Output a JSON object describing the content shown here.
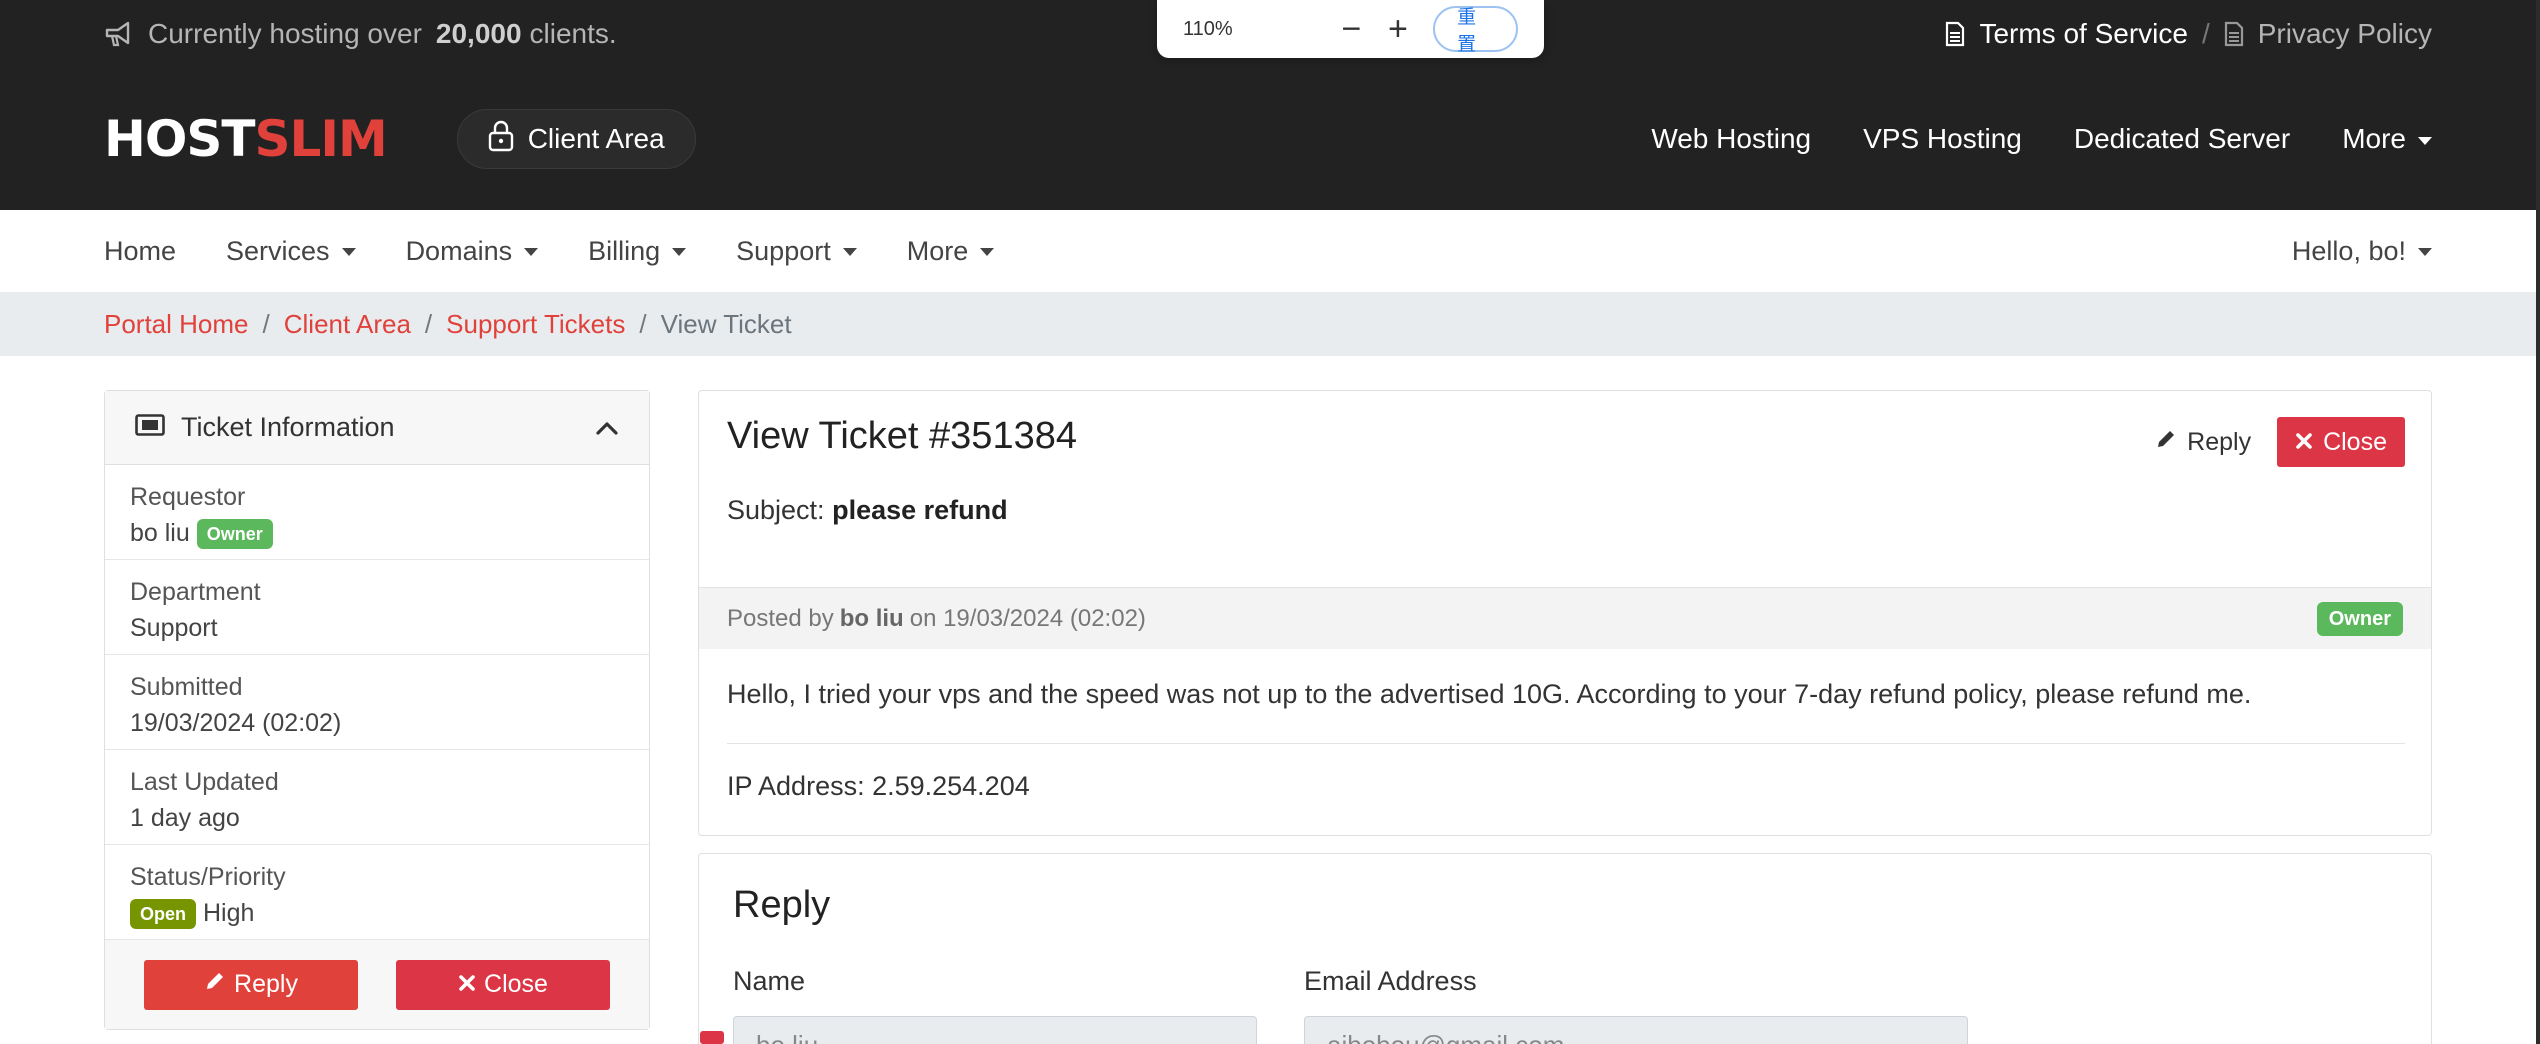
{
  "topbar": {
    "announcement_prefix": "Currently hosting over",
    "announcement_count": "20,000",
    "announcement_suffix": "clients.",
    "terms": "Terms of Service",
    "separator": "/",
    "privacy": "Privacy Policy"
  },
  "zoom": {
    "level": "110%",
    "minus": "−",
    "plus": "+",
    "reset": "重置"
  },
  "header": {
    "logo_host": "HOST",
    "logo_slim": "SLIM",
    "client_area": "Client Area",
    "nav": [
      "Web Hosting",
      "VPS Hosting",
      "Dedicated Server",
      "More"
    ]
  },
  "subnav": {
    "home": "Home",
    "services": "Services",
    "domains": "Domains",
    "billing": "Billing",
    "support": "Support",
    "more": "More",
    "user": "Hello, bo!"
  },
  "breadcrumb": {
    "portal_home": "Portal Home",
    "client_area": "Client Area",
    "support_tickets": "Support Tickets",
    "current": "View Ticket",
    "sep": "/"
  },
  "sidebar": {
    "title": "Ticket Information",
    "requestor_label": "Requestor",
    "requestor_value": "bo liu",
    "owner_badge": "Owner",
    "department_label": "Department",
    "department_value": "Support",
    "submitted_label": "Submitted",
    "submitted_value": "19/03/2024 (02:02)",
    "updated_label": "Last Updated",
    "updated_value": "1 day ago",
    "status_label": "Status/Priority",
    "status_badge": "Open",
    "priority_value": "High",
    "reply_button": "Reply",
    "close_button": "Close"
  },
  "ticket": {
    "title": "View Ticket #351384",
    "reply_link": "Reply",
    "close_button": "Close",
    "subject_label": "Subject:",
    "subject_value": "please refund",
    "posted_by": "Posted by",
    "author": "bo liu",
    "posted_on": "on 19/03/2024 (02:02)",
    "author_badge": "Owner",
    "message": "Hello, I tried your vps and the speed was not up to the advertised 10G. According to your 7-day refund policy, please refund me.",
    "ip": "IP Address: 2.59.254.204"
  },
  "reply": {
    "title": "Reply",
    "name_label": "Name",
    "email_label": "Email Address",
    "name_value": "bo liu",
    "email_value": "aibobou@gmail.com"
  },
  "colors": {
    "brand_red": "#e0423b",
    "danger": "#dc3545",
    "owner_green": "#5cb85c",
    "open_green": "#779500",
    "dark_bg": "#222222"
  }
}
